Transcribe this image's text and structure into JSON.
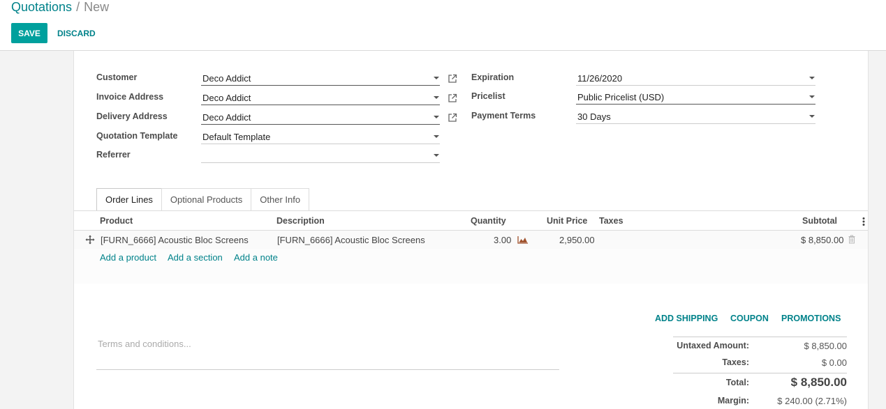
{
  "breadcrumb": {
    "parent": "Quotations",
    "separator": "/",
    "current": "New"
  },
  "buttons": {
    "save": "SAVE",
    "discard": "DISCARD"
  },
  "form": {
    "left": [
      {
        "label": "Customer",
        "value": "Deco Addict"
      },
      {
        "label": "Invoice Address",
        "value": "Deco Addict"
      },
      {
        "label": "Delivery Address",
        "value": "Deco Addict"
      },
      {
        "label": "Quotation Template",
        "value": "Default Template"
      },
      {
        "label": "Referrer",
        "value": ""
      }
    ],
    "right": [
      {
        "label": "Expiration",
        "value": "11/26/2020"
      },
      {
        "label": "Pricelist",
        "value": "Public Pricelist (USD)"
      },
      {
        "label": "Payment Terms",
        "value": "30 Days"
      }
    ]
  },
  "tabs": [
    "Order Lines",
    "Optional Products",
    "Other Info"
  ],
  "table": {
    "columns": {
      "product": "Product",
      "description": "Description",
      "quantity": "Quantity",
      "unit_price": "Unit Price",
      "taxes": "Taxes",
      "subtotal": "Subtotal"
    },
    "rows": [
      {
        "product": "[FURN_6666] Acoustic Bloc Screens",
        "description": "[FURN_6666] Acoustic Bloc Screens",
        "quantity": "3.00",
        "unit_price": "2,950.00",
        "taxes": "",
        "subtotal": "$ 8,850.00"
      }
    ],
    "add_links": {
      "product": "Add a product",
      "section": "Add a section",
      "note": "Add a note"
    }
  },
  "actions": {
    "shipping": "ADD SHIPPING",
    "coupon": "COUPON",
    "promotions": "PROMOTIONS"
  },
  "terms_placeholder": "Terms and conditions...",
  "totals": {
    "untaxed_label": "Untaxed Amount:",
    "untaxed": "$ 8,850.00",
    "taxes_label": "Taxes:",
    "taxes": "$ 0.00",
    "total_label": "Total:",
    "total": "$ 8,850.00",
    "margin_label": "Margin:",
    "margin": "$ 240.00 (2.71%)"
  },
  "colors": {
    "accent": "#00a09d",
    "link": "#00828a",
    "forecast_icon": "#a0522d"
  }
}
